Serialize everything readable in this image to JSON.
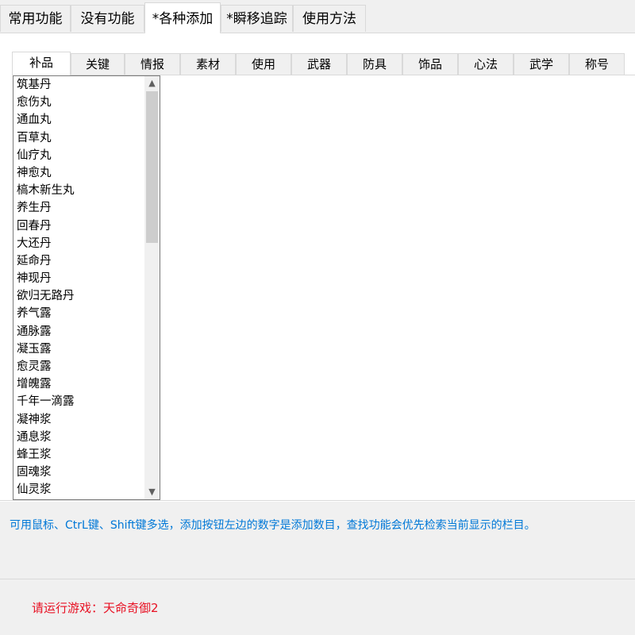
{
  "top_tabs": [
    {
      "label": "常用功能",
      "active": false
    },
    {
      "label": "没有功能",
      "active": false
    },
    {
      "label": "*各种添加",
      "active": true
    },
    {
      "label": "*瞬移追踪",
      "active": false
    },
    {
      "label": "使用方法",
      "active": false
    }
  ],
  "sub_tabs": [
    {
      "label": "补品",
      "active": true
    },
    {
      "label": "关键",
      "active": false
    },
    {
      "label": "情报",
      "active": false
    },
    {
      "label": "素材",
      "active": false
    },
    {
      "label": "使用",
      "active": false
    },
    {
      "label": "武器",
      "active": false
    },
    {
      "label": "防具",
      "active": false
    },
    {
      "label": "饰品",
      "active": false
    },
    {
      "label": "心法",
      "active": false
    },
    {
      "label": "武学",
      "active": false
    },
    {
      "label": "称号",
      "active": false
    }
  ],
  "item_list": [
    "筑基丹",
    "愈伤丸",
    "通血丸",
    "百草丸",
    "仙疗丸",
    "神愈丸",
    "槁木新生丸",
    "养生丹",
    "回春丹",
    "大还丹",
    "延命丹",
    "神现丹",
    "欲归无路丹",
    "养气露",
    "通脉露",
    "凝玉露",
    "愈灵露",
    "增魄露",
    "千年一滴露",
    "凝神浆",
    "通息浆",
    "蜂王浆",
    "固魂浆",
    "仙灵浆"
  ],
  "hint_text": "可用鼠标、CtrL键、Shift键多选，添加按钮左边的数字是添加数目，查找功能会优先检索当前显示的栏目。",
  "status_text": "请运行游戏：天命奇御2",
  "icons": {
    "scroll_up": "▲",
    "scroll_down": "▼"
  },
  "colors": {
    "hint": "#0078d7",
    "status": "#e81123",
    "panel": "#ffffff",
    "window": "#f0f0f0"
  }
}
